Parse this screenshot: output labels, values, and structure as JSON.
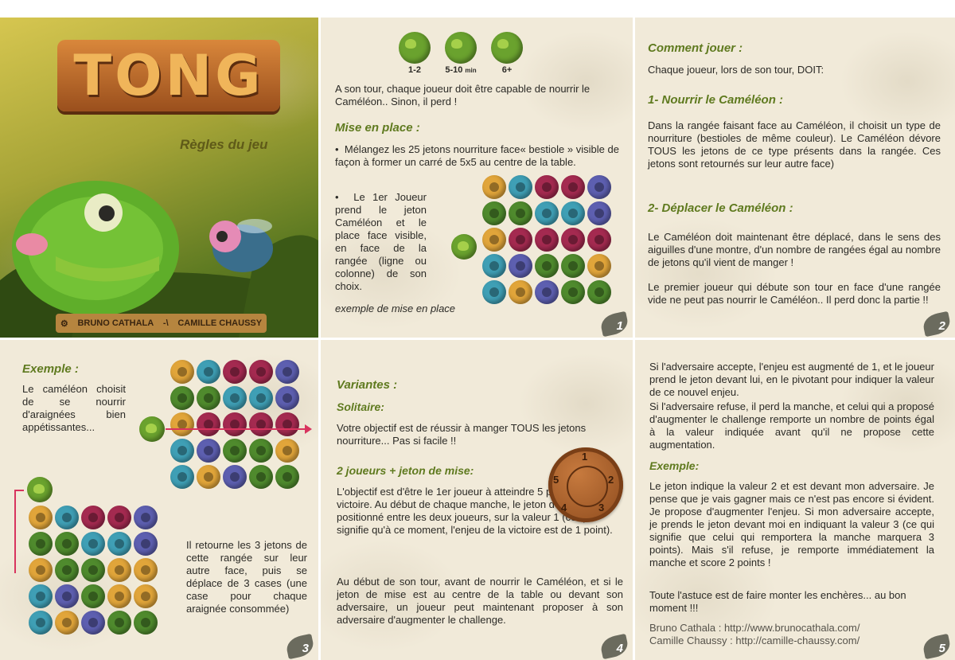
{
  "cover": {
    "logo": "TONG",
    "subtitle": "Règles du jeu",
    "author1": "BRUNO CATHALA",
    "author2": "CAMILLE CHAUSSY"
  },
  "p1": {
    "badges": [
      {
        "label": "1-2"
      },
      {
        "label": "5-10",
        "unit": "min"
      },
      {
        "label": "6+"
      }
    ],
    "intro": "A son tour, chaque joueur doit être capable de nourrir le Caméléon.. Sinon, il perd !",
    "setup_title": "Mise en place :",
    "bullet1": "Mélangez les 25 jetons nourriture face« bestiole » visible de façon à former un carré de 5x5 au centre de la table.",
    "bullet2": "Le 1er Joueur prend le jeton Caméléon et le place face visible, en face de la rangée (ligne ou colonne) de son choix.",
    "caption": "exemple de mise en place",
    "page": "1"
  },
  "p2": {
    "title": "Comment jouer :",
    "intro": "Chaque joueur, lors de son tour, DOIT:",
    "s1_title": "1- Nourrir le Caméléon :",
    "s1_text": "Dans la rangée faisant face au Caméléon, il choisit un type de nourriture (bestioles de même couleur). Le Caméléon dévore TOUS les jetons de ce type présents dans la rangée. Ces jetons sont retournés sur leur autre face)",
    "s2_title": "2- Déplacer le Caméléon :",
    "s2_text": "Le Caméléon doit maintenant être déplacé, dans le sens des aiguilles d'une montre, d'un nombre de rangées égal au nombre de jetons qu'il vient de manger !",
    "s2_text2": "Le premier joueur qui débute son tour en face d'une rangée vide ne peut pas nourrir le Caméléon.. Il perd donc la partie !!",
    "page": "2"
  },
  "p3": {
    "title": "Exemple :",
    "text1": "Le caméléon choisit de se nourrir d'araignées bien appétissantes...",
    "text2": "Il retourne les 3 jetons de cette rangée sur leur autre face, puis se déplace de 3 cases (une case pour chaque araignée consommée)",
    "page": "3"
  },
  "p4": {
    "title": "Variantes :",
    "solo_title": "Solitaire:",
    "solo_text": "Votre objectif est de réussir à manger TOUS les jetons nourriture... Pas si facile !!",
    "duo_title": "2 joueurs + jeton de mise:",
    "duo_text": "L'objectif est d'être le 1er joueur à atteindre 5 points de victoire. Au début de chaque manche, le jeton de mise est positionné entre les deux joueurs, sur la valeur 1 (ce qui signifie qu'à ce moment, l'enjeu de la victoire est de 1 point).",
    "duo_text2": "Au début de son tour, avant de nourrir le Caméléon, et si le jeton de mise est au centre de la table ou devant son adversaire, un joueur peut maintenant proposer à son adversaire d'augmenter le challenge.",
    "coin": {
      "n1": "1",
      "n2": "2",
      "n3": "3",
      "n4": "4",
      "n5": "5"
    },
    "page": "4"
  },
  "p5": {
    "text1": "Si l'adversaire accepte, l'enjeu est augmenté de 1, et le joueur prend le jeton devant lui, en le pivotant pour indiquer la valeur de ce nouvel enjeu.",
    "text2": "Si l'adversaire refuse, il perd la manche, et celui qui a proposé d'augmenter le challenge remporte un nombre de points égal à la valeur indiquée avant qu'il ne propose cette augmentation.",
    "ex_title": "Exemple:",
    "ex_text": "Le jeton indique la valeur 2 et est devant mon adversaire. Je pense que je vais gagner mais ce n'est pas encore si évident. Je propose d'augmenter l'enjeu. Si mon adversaire accepte, je prends le jeton devant moi en indiquant la valeur 3 (ce qui signifie que celui qui remportera la manche marquera 3 points). Mais s'il refuse, je remporte immédiatement la manche et score 2 points !",
    "ex_text2": "Toute l'astuce est de faire monter les enchères... au bon moment !!!",
    "credit1": "Bruno Cathala : http://www.brunocathala.com/",
    "credit2": "Camille Chaussy : http://camille-chaussy.com/",
    "page": "5"
  },
  "colors": {
    "accent": "#5f7a1f",
    "paper": "#f1ead9"
  }
}
